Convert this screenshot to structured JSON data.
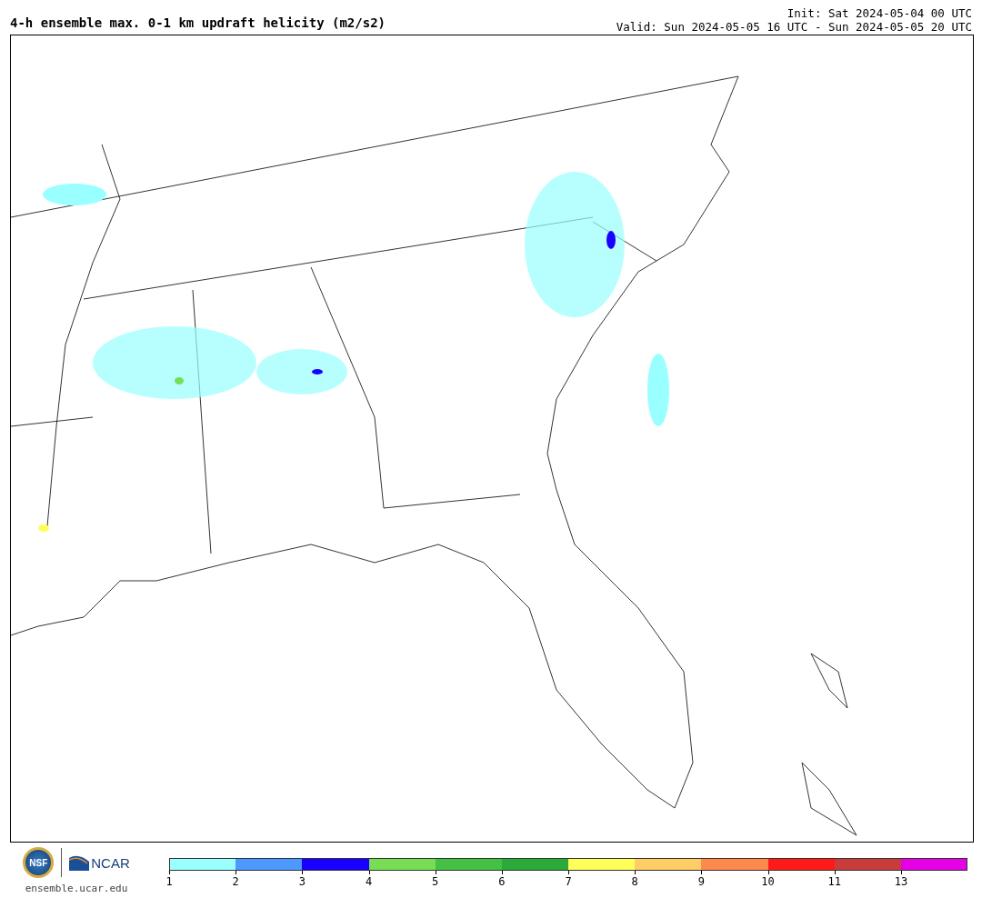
{
  "title": "4-h ensemble max. 0-1 km updraft helicity (m2/s2)",
  "init": "Init: Sat 2024-05-04 00 UTC",
  "valid": "Valid: Sun 2024-05-05 16 UTC - Sun 2024-05-05 20 UTC",
  "logos": {
    "nsf": "NSF",
    "ncar": "NCAR",
    "site": "ensemble.ucar.edu"
  },
  "colorbar": [
    {
      "label": "1",
      "color": "#99ffff"
    },
    {
      "label": "2",
      "color": "#4d99ff"
    },
    {
      "label": "3",
      "color": "#1a00ff"
    },
    {
      "label": "4",
      "color": "#77dd55"
    },
    {
      "label": "5",
      "color": "#44c044"
    },
    {
      "label": "6",
      "color": "#2aaa38"
    },
    {
      "label": "7",
      "color": "#ffff5a"
    },
    {
      "label": "8",
      "color": "#ffcc66"
    },
    {
      "label": "9",
      "color": "#ff884d"
    },
    {
      "label": "10",
      "color": "#ff1a1a"
    },
    {
      "label": "11",
      "color": "#c83c3c"
    },
    {
      "label": "13",
      "color": "#e600e6"
    }
  ]
}
